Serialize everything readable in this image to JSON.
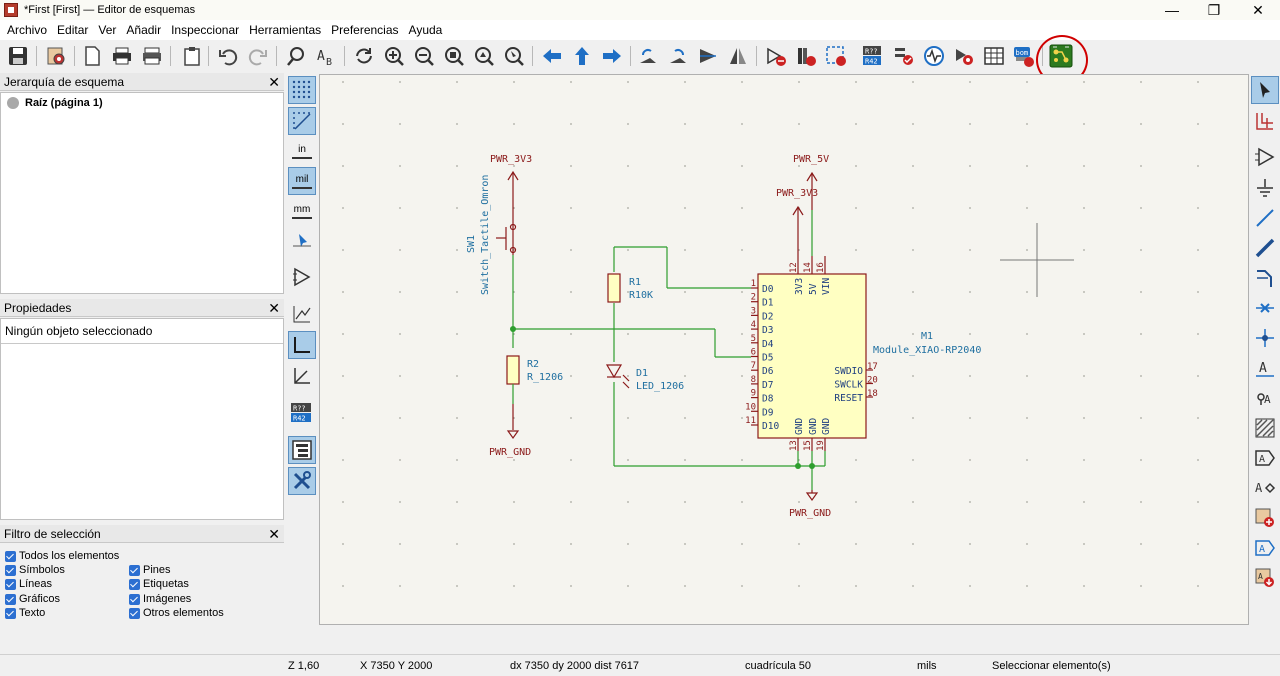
{
  "window": {
    "title": "*First [First] — Editor de esquemas",
    "minimize": "—",
    "maximize": "❐",
    "close": "✕"
  },
  "menu": [
    "Archivo",
    "Editar",
    "Ver",
    "Añadir",
    "Inspeccionar",
    "Herramientas",
    "Preferencias",
    "Ayuda"
  ],
  "hierarchy": {
    "title": "Jerarquía de esquema",
    "close": "✕",
    "root": "Raíz (página 1)"
  },
  "properties": {
    "title": "Propiedades",
    "close": "✕",
    "empty": "Ningún objeto seleccionado"
  },
  "selection_filter": {
    "title": "Filtro de selección",
    "close": "✕",
    "items": [
      {
        "label": "Todos los elementos",
        "checked": true
      },
      {
        "label": "Símbolos",
        "checked": true
      },
      {
        "label": "Pines",
        "checked": true
      },
      {
        "label": "Líneas",
        "checked": true
      },
      {
        "label": "Etiquetas",
        "checked": true
      },
      {
        "label": "Gráficos",
        "checked": true
      },
      {
        "label": "Imágenes",
        "checked": true
      },
      {
        "label": "Texto",
        "checked": true
      },
      {
        "label": "Otros elementos",
        "checked": true
      }
    ]
  },
  "left_tools": {
    "in": "in",
    "mil": "mil",
    "mm": "mm",
    "r_top": "R??",
    "r_bot": "R42"
  },
  "toolbar_badges": {
    "r_top": "R??",
    "r_bot": "R42",
    "bom": "bom"
  },
  "schematic": {
    "pwr_3v3_left": "PWR_3V3",
    "pwr_5v": "PWR_5V",
    "pwr_3v3_right": "PWR_3V3",
    "pwr_gnd_left": "PWR_GND",
    "pwr_gnd_right": "PWR_GND",
    "sw1_ref": "SW1",
    "sw1_value": "Switch_Tactile_Omron",
    "r1_ref": "R1",
    "r1_value": "R10K",
    "r2_ref": "R2",
    "r2_value": "R_1206",
    "d1_ref": "D1",
    "d1_value": "LED_1206",
    "m1_ref": "M1",
    "m1_value": "Module_XIAO-RP2040",
    "left_pins": [
      {
        "num": "1",
        "name": "D0"
      },
      {
        "num": "2",
        "name": "D1"
      },
      {
        "num": "3",
        "name": "D2"
      },
      {
        "num": "4",
        "name": "D3"
      },
      {
        "num": "5",
        "name": "D4"
      },
      {
        "num": "6",
        "name": "D5"
      },
      {
        "num": "7",
        "name": "D6"
      },
      {
        "num": "8",
        "name": "D7"
      },
      {
        "num": "9",
        "name": "D8"
      },
      {
        "num": "10",
        "name": "D9"
      },
      {
        "num": "11",
        "name": "D10"
      }
    ],
    "top_pins": [
      {
        "num": "12",
        "name": "3V3"
      },
      {
        "num": "14",
        "name": "5V"
      },
      {
        "num": "16",
        "name": "VIN"
      }
    ],
    "right_pins": [
      {
        "num": "17",
        "name": "SWDIO"
      },
      {
        "num": "20",
        "name": "SWCLK"
      },
      {
        "num": "18",
        "name": "RESET"
      }
    ],
    "bottom_pins": [
      {
        "num": "13",
        "name": "GND"
      },
      {
        "num": "15",
        "name": "GND"
      },
      {
        "num": "19",
        "name": "GND"
      }
    ]
  },
  "status": {
    "zoom": "Z 1,60",
    "xy": "X 7350  Y 2000",
    "delta": "dx 7350  dy 2000  dist 7617",
    "grid": "cuadrícula 50",
    "units": "mils",
    "mode": "Seleccionar elemento(s)"
  },
  "colors": {
    "wire": "#2e9e2e",
    "symbol": "#8b1a1a",
    "body_fill": "#ffffc2",
    "highlight_circle": "#d00000"
  }
}
